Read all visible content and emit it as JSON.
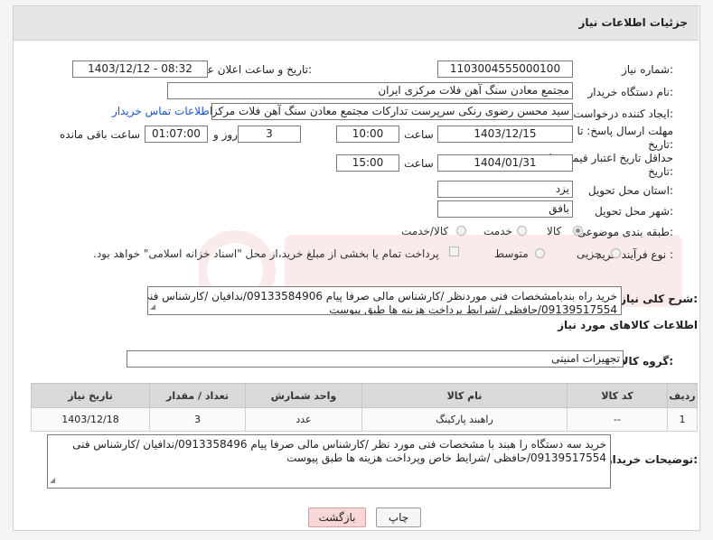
{
  "header": {
    "title": "جزئیات اطلاعات نیاز"
  },
  "form": {
    "need_number": {
      "label": "شماره نیاز:",
      "value": "1103004555000100"
    },
    "announce": {
      "label": "تاریخ و ساعت اعلان عمومی:",
      "value": "1403/12/12 - 08:32"
    },
    "buyer_org": {
      "label": "نام دستگاه خریدار:",
      "value": "مجتمع معادن سنگ آهن فلات مرکزی ایران"
    },
    "requester": {
      "label": "ایجاد کننده درخواست:",
      "value": "سید محسن رضوی رنکی سرپرست تدارکات مجتمع معادن سنگ آهن فلات مرکز",
      "contact_link": "اطلاعات تماس خریدار"
    },
    "deadline": {
      "label_line1": "مهلت ارسال پاسخ: تا",
      "label_line2": "تاریخ:",
      "date": "1403/12/15",
      "time_label": "ساعت",
      "time": "10:00",
      "days": "3",
      "days_label": "روز و",
      "remaining": "01:07:00",
      "remaining_label": "ساعت باقی مانده"
    },
    "validity": {
      "label_line1": "حداقل تاریخ اعتبار قیمت: تا",
      "label_line2": "تاریخ:",
      "date": "1404/01/31",
      "time_label": "ساعت",
      "time": "15:00"
    },
    "province": {
      "label": "استان محل تحویل:",
      "value": "یزد"
    },
    "city": {
      "label": "شهر محل تحویل:",
      "value": "بافق"
    },
    "category": {
      "label": "طبقه بندی موضوعی:",
      "options": [
        "کالا",
        "خدمت",
        "کالا/خدمت"
      ],
      "selected": "کالا"
    },
    "process": {
      "label": "نوع فرآیند خرید :",
      "options": [
        "جزیی",
        "متوسط"
      ],
      "payment_note": "پرداخت تمام یا بخشی از مبلغ خرید،از محل \"اسناد خزانه اسلامی\" خواهد بود."
    }
  },
  "summary": {
    "label": "شرح کلی نیاز:",
    "line1": "خرید راه بندبامشخصات فنی موردنظر /کارشناس مالی صرفا پیام 09133584906/ندافیان /کارشناس فنی",
    "line2": "09139517554/حافظی /شرایط پرداخت هزینه ها طبق پیوست"
  },
  "goods_section": {
    "title": "اطلاعات کالاهای مورد نیاز"
  },
  "goods_group": {
    "label": "گروه کالا:",
    "value": "تجهیزات امنیتی"
  },
  "table": {
    "headers": [
      "ردیف",
      "کد کالا",
      "نام کالا",
      "واحد شمارش",
      "تعداد / مقدار",
      "تاریخ نیاز"
    ],
    "rows": [
      [
        "1",
        "--",
        "راهبند پارکینگ",
        "عدد",
        "3",
        "1403/12/18"
      ]
    ]
  },
  "buyer_notes": {
    "label": "توضیحات خریدار:",
    "line1": "خرید سه دستگاه را هبند با مشخصات فنی مورد نظر /کارشناس مالی صرفا پیام 0913358496/ندافیان /کارشناس فنی",
    "line2": "09139517554/حافظی /شرایط خاص وپرداخت هزینه ها طبق پیوست"
  },
  "buttons": {
    "print": "چاپ",
    "back": "بازگشت"
  },
  "colors": {
    "link": "#1a55c9",
    "header_bg": "#e6e6e6",
    "back_button_bg": "#f7d7d7"
  }
}
